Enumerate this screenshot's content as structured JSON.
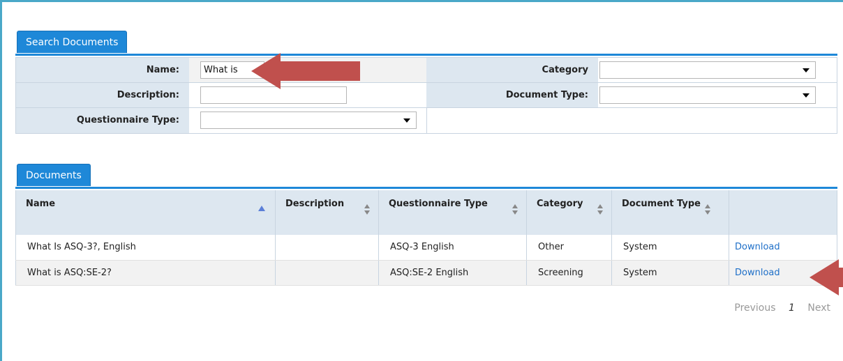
{
  "search": {
    "tab_label": "Search Documents",
    "name_label": "Name:",
    "name_value": "What is ",
    "description_label": "Description:",
    "description_value": "",
    "questionnaire_type_label": "Questionnaire Type:",
    "questionnaire_type_value": "",
    "category_label": "Category",
    "category_value": "",
    "document_type_label": "Document Type:",
    "document_type_value": ""
  },
  "documents": {
    "tab_label": "Documents",
    "columns": [
      "Name",
      "Description",
      "Questionnaire Type",
      "Category",
      "Document Type",
      ""
    ],
    "rows": [
      {
        "name": "What Is ASQ-3?, English",
        "description": "",
        "questionnaire_type": "ASQ-3 English",
        "category": "Other",
        "document_type": "System",
        "action": "Download"
      },
      {
        "name": "What is ASQ:SE-2?",
        "description": "",
        "questionnaire_type": "ASQ:SE-2 English",
        "category": "Screening",
        "document_type": "System",
        "action": "Download"
      }
    ]
  },
  "pager": {
    "previous": "Previous",
    "page": "1",
    "next": "Next"
  },
  "colors": {
    "tab": "#1e88d8",
    "label_bg": "#dde7f0",
    "link": "#1e6fc8",
    "annotation_arrow": "#c0504d"
  }
}
